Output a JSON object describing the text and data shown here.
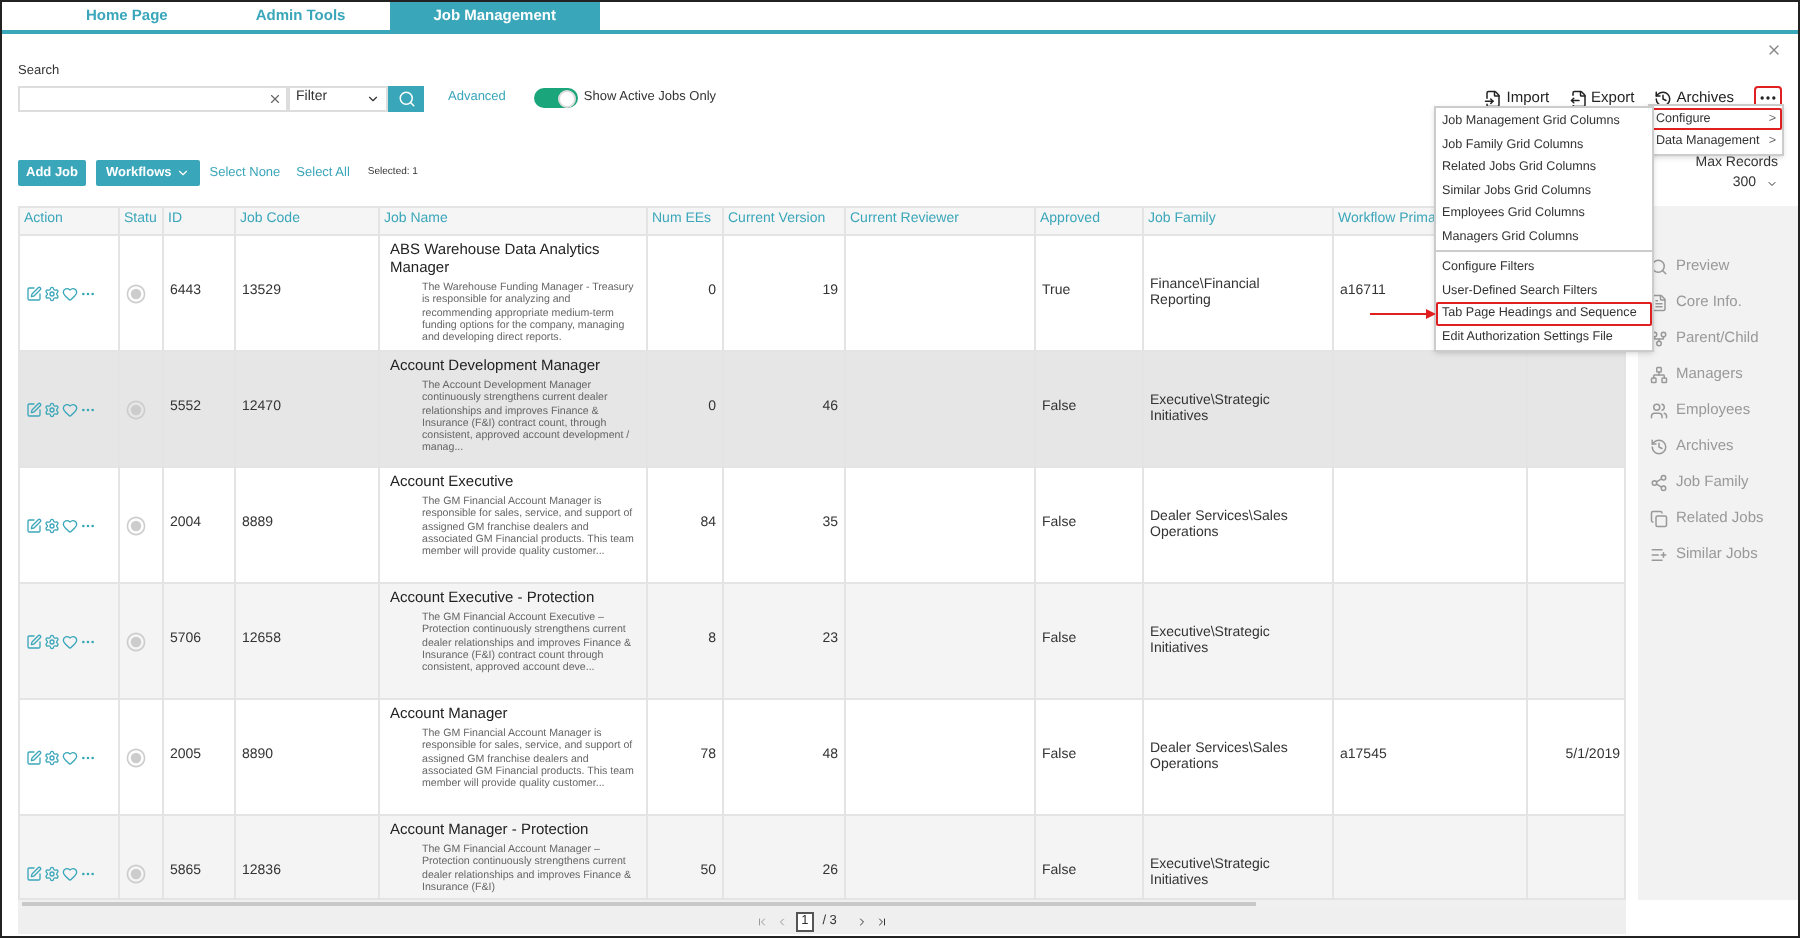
{
  "tabs": [
    {
      "label": "Home Page",
      "selected": false
    },
    {
      "label": "Admin Tools",
      "selected": false
    },
    {
      "label": "Job Management",
      "selected": true
    }
  ],
  "search": {
    "label": "Search",
    "filter": "Filter",
    "advanced": "Advanced",
    "toggle": {
      "label": "Show Active Jobs Only",
      "on": true
    }
  },
  "toolbar": [
    {
      "kind": "import",
      "label": "Import",
      "highlighted": false
    },
    {
      "kind": "export",
      "label": "Export",
      "highlighted": false
    },
    {
      "kind": "archives",
      "label": "Archives",
      "highlighted": false
    },
    {
      "kind": "more",
      "highlighted": true
    }
  ],
  "menu": [
    {
      "label": "Configure",
      "arrow": ">",
      "highlighted": true
    },
    {
      "label": "Data Management",
      "arrow": ">",
      "highlighted": false
    }
  ],
  "submenu": [
    [
      {
        "label": "Job Management Grid Columns",
        "highlighted": false
      },
      {
        "label": "Job Family Grid Columns",
        "highlighted": false
      },
      {
        "label": "Related Jobs Grid Columns",
        "highlighted": false
      },
      {
        "label": "Similar Jobs Grid Columns",
        "highlighted": false
      },
      {
        "label": "Employees Grid Columns",
        "highlighted": false
      },
      {
        "label": "Managers Grid Columns",
        "highlighted": false
      }
    ],
    [
      {
        "label": "Configure Filters",
        "highlighted": false
      },
      {
        "label": "User-Defined Search Filters",
        "highlighted": false
      },
      {
        "label": "Tab Page Headings and Sequence",
        "highlighted": true
      },
      {
        "label": "Edit Authorization Settings File",
        "highlighted": false
      }
    ]
  ],
  "max_records": {
    "label": "Max Records",
    "value": "300"
  },
  "actions": {
    "add_job": "Add Job",
    "workflows": "Workflows",
    "select_none": "Select None",
    "select_all": "Select All",
    "selected": "Selected: 1"
  },
  "table": {
    "columns": [
      "Action",
      "Statu",
      "ID",
      "Job Code",
      "Job Name",
      "Num EEs",
      "Current Version",
      "Current Reviewer",
      "Approved",
      "Job Family",
      "Workflow Prima"
    ],
    "rows": [
      {
        "selected": false,
        "id": "6443",
        "job_code": "13529",
        "title": "ABS Warehouse Data Analytics Manager",
        "description": "The Warehouse Funding Manager - Treasury is responsible for analyzing and recommending appropriate medium-term funding options for the company, managing and developing direct reports.",
        "num_ees": "0",
        "current_version": "19",
        "approved": "True",
        "job_family": "Finance\\Financial Reporting",
        "workflow_primary": "a16711"
      },
      {
        "selected": true,
        "id": "5552",
        "job_code": "12470",
        "title": "Account Development Manager",
        "description": "The Account Development Manager continuously strengthens current dealer relationships and improves Finance & Insurance (F&I) contract count, through consistent, approved account development / manag...",
        "num_ees": "0",
        "current_version": "46",
        "approved": "False",
        "job_family": "Executive\\Strategic Initiatives"
      },
      {
        "selected": false,
        "id": "2004",
        "job_code": "8889",
        "title": "Account Executive",
        "description": "The GM Financial Account Manager is responsible for sales, service, and support of assigned GM franchise dealers and associated GM Financial products. This team member will provide quality customer...",
        "num_ees": "84",
        "current_version": "35",
        "approved": "False",
        "job_family": "Dealer Services\\Sales Operations"
      },
      {
        "selected": false,
        "id": "5706",
        "job_code": "12658",
        "title": "Account Executive - Protection",
        "description": "The GM Financial Account Executive – Protection continuously strengthens current dealer relationships and improves Finance & Insurance (F&I) contract count through consistent, approved account deve...",
        "num_ees": "8",
        "current_version": "23",
        "approved": "False",
        "job_family": "Executive\\Strategic Initiatives"
      },
      {
        "selected": false,
        "id": "2005",
        "job_code": "8890",
        "title": "Account Manager",
        "description": "The GM Financial Account Manager is responsible for sales, service, and support of assigned GM franchise dealers and associated GM Financial products. This team member will provide quality customer...",
        "num_ees": "78",
        "current_version": "48",
        "approved": "False",
        "job_family": "Dealer Services\\Sales Operations",
        "workflow_primary": "a17545",
        "column_12": "5/1/2019"
      },
      {
        "selected": false,
        "id": "5865",
        "job_code": "12836",
        "title": "Account Manager - Protection",
        "description": "The GM Financial Account Manager – Protection continuously strengthens current dealer relationships and improves Finance & Insurance (F&I)",
        "num_ees": "50",
        "current_version": "26",
        "approved": "False",
        "job_family": "Executive\\Strategic Initiatives"
      }
    ]
  },
  "pagination": {
    "page": "1",
    "total": "/ 3"
  },
  "side_panel": [
    {
      "kind": "preview",
      "label": "Preview"
    },
    {
      "kind": "core",
      "label": "Core Info."
    },
    {
      "kind": "parent",
      "label": "Parent/Child"
    },
    {
      "kind": "managers",
      "label": "Managers"
    },
    {
      "kind": "employees",
      "label": "Employees"
    },
    {
      "kind": "archives",
      "label": "Archives"
    },
    {
      "kind": "family",
      "label": "Job Family"
    },
    {
      "kind": "related",
      "label": "Related Jobs"
    },
    {
      "kind": "similar",
      "label": "Similar Jobs"
    }
  ]
}
